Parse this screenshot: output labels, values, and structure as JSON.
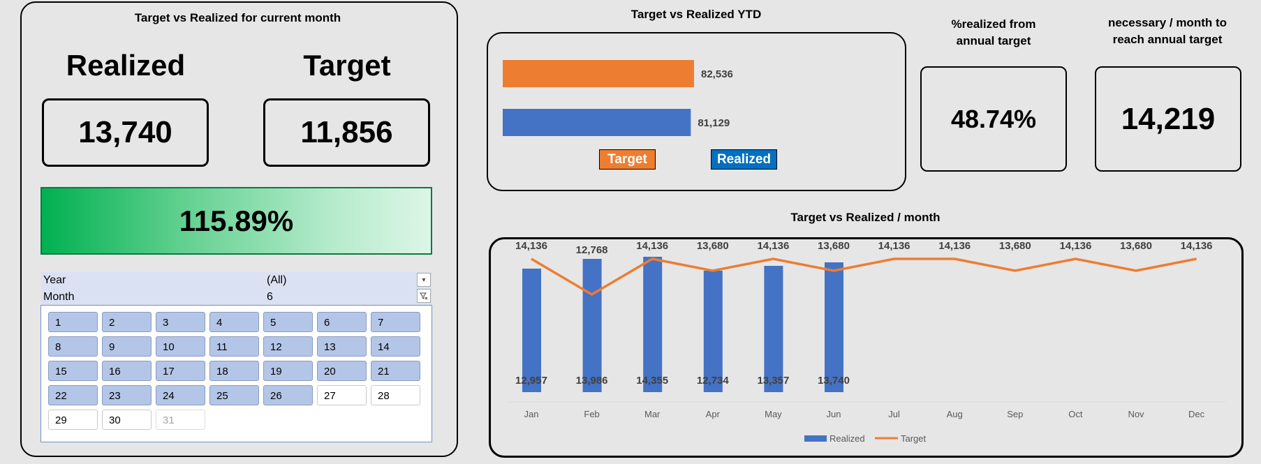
{
  "current_month": {
    "title": "Target vs Realized for current month",
    "realized_label": "Realized",
    "target_label": "Target",
    "realized_value": "13,740",
    "target_value": "11,856",
    "percent_text": "115.89%",
    "percent_value": 115.89
  },
  "filters": {
    "year_label": "Year",
    "year_value": "(All)",
    "month_label": "Month",
    "month_value": "6"
  },
  "month_slicer": {
    "days": [
      "1",
      "2",
      "3",
      "4",
      "5",
      "6",
      "7",
      "8",
      "9",
      "10",
      "11",
      "12",
      "13",
      "14",
      "15",
      "16",
      "17",
      "18",
      "19",
      "20",
      "21",
      "22",
      "23",
      "24",
      "25",
      "26",
      "27",
      "28",
      "29",
      "30",
      "31"
    ]
  },
  "ytd": {
    "title": "Target vs Realized YTD",
    "target_value_text": "82,536",
    "realized_value_text": "81,129",
    "legend_target": "Target",
    "legend_realized": "Realized",
    "colors": {
      "target": "#ed7d31",
      "realized": "#4472c4"
    }
  },
  "pct_annual": {
    "title_line1": "%realized from",
    "title_line2": "annual target",
    "value": "48.74%"
  },
  "necessary": {
    "title_line1": "necessary / month to",
    "title_line2": "reach annual target",
    "value": "14,219"
  },
  "monthly": {
    "title": "Target vs Realized / month",
    "legend_realized": "Realized",
    "legend_target": "Target"
  },
  "chart_data": [
    {
      "type": "bar",
      "title": "Target vs Realized YTD",
      "categories": [
        "Target",
        "Realized"
      ],
      "values": [
        82536,
        81129
      ],
      "colors": [
        "#ed7d31",
        "#4472c4"
      ]
    },
    {
      "type": "bar",
      "title": "Target vs Realized / month",
      "categories": [
        "Jan",
        "Feb",
        "Mar",
        "Apr",
        "May",
        "Jun",
        "Jul",
        "Aug",
        "Sep",
        "Oct",
        "Nov",
        "Dec"
      ],
      "series": [
        {
          "name": "Realized",
          "type": "bar",
          "color": "#4472c4",
          "values": [
            12957,
            13986,
            14355,
            12734,
            13357,
            13740,
            null,
            null,
            null,
            null,
            null,
            null
          ]
        },
        {
          "name": "Target",
          "type": "line",
          "color": "#ed7d31",
          "values": [
            14136,
            12768,
            14136,
            13680,
            14136,
            13680,
            14136,
            14136,
            13680,
            14136,
            13680,
            14136
          ]
        }
      ],
      "legend": "bottom",
      "grid": false
    }
  ]
}
